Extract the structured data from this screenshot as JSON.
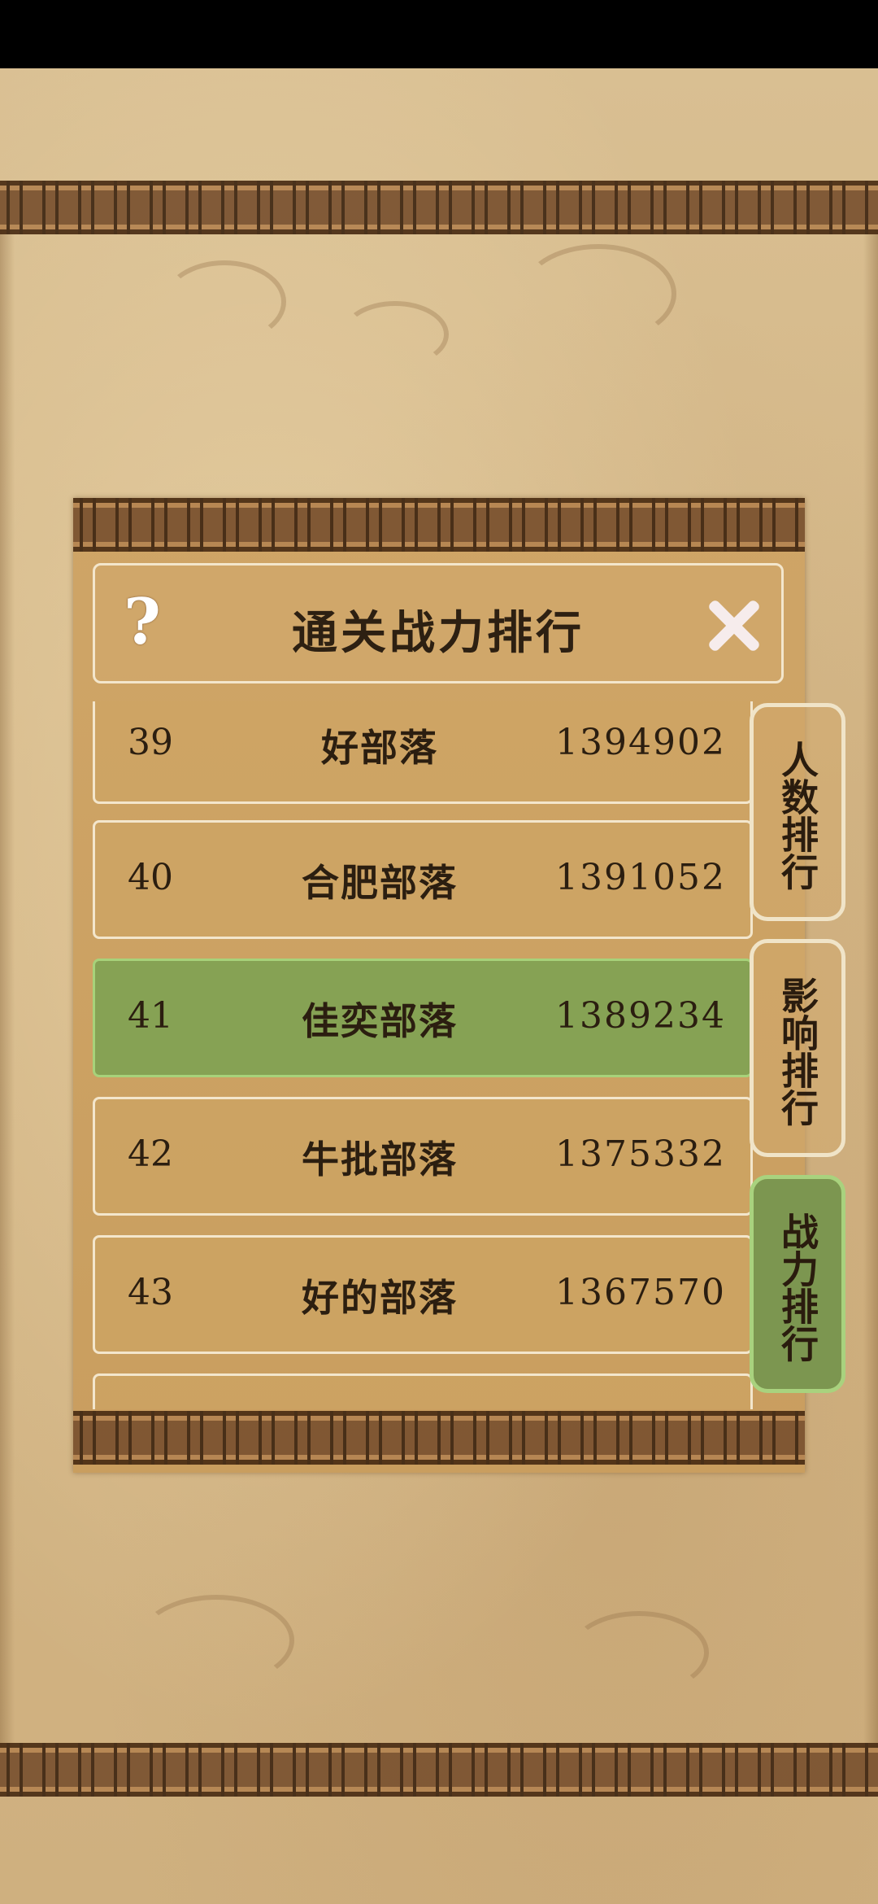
{
  "dialog": {
    "title": "通关战力排行",
    "help_icon": "?",
    "close_icon": "close-x"
  },
  "rankings": [
    {
      "rank": "39",
      "name": "好部落",
      "power": "1394902",
      "highlight": false
    },
    {
      "rank": "40",
      "name": "合肥部落",
      "power": "1391052",
      "highlight": false
    },
    {
      "rank": "41",
      "name": "佳奕部落",
      "power": "1389234",
      "highlight": true
    },
    {
      "rank": "42",
      "name": "牛批部落",
      "power": "1375332",
      "highlight": false
    },
    {
      "rank": "43",
      "name": "好的部落",
      "power": "1367570",
      "highlight": false
    }
  ],
  "tabs": [
    {
      "label": "人数排行",
      "active": false
    },
    {
      "label": "影响排行",
      "active": false
    },
    {
      "label": "战力排行",
      "active": true
    }
  ],
  "colors": {
    "highlight_row": "#86a254",
    "active_tab": "#7c9650",
    "parchment": "#d6b98a"
  }
}
